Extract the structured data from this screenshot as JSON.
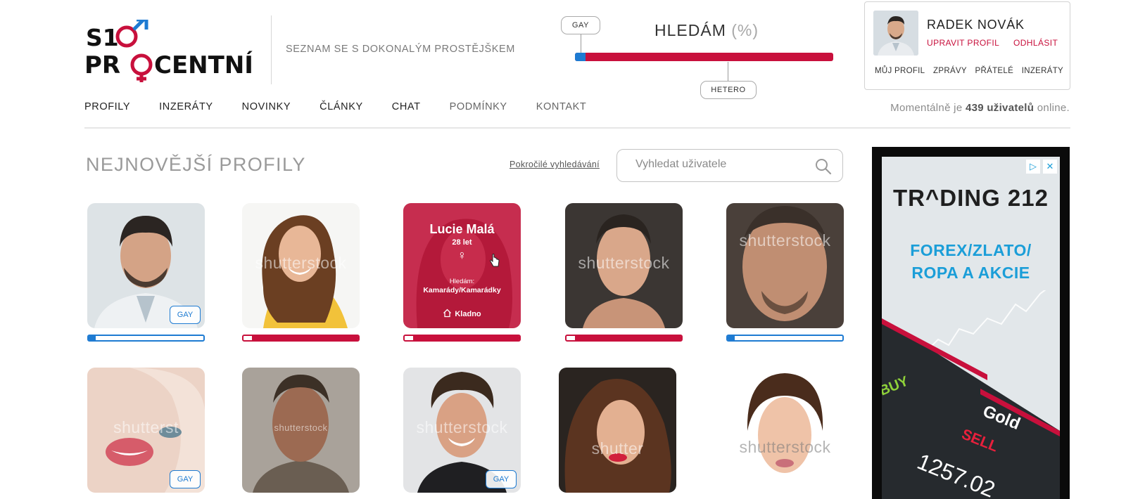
{
  "header": {
    "logo_line1": "S10",
    "logo_line2": "PROCENTNÍ",
    "tagline": "SEZNAM SE S DOKONALÝM PROSTĚJŠKEM",
    "seek_title": "HLEDÁM",
    "seek_unit": "(%)",
    "seek_left_label": "GAY",
    "seek_right_label": "HETERO",
    "seek_level": 0.04
  },
  "user": {
    "name": "RADEK NOVÁK",
    "edit_label": "UPRAVIT PROFIL",
    "logout_label": "ODHLÁSIT",
    "links": [
      "MŮJ PROFIL",
      "ZPRÁVY",
      "PŘÁTELÉ",
      "INZERÁTY"
    ]
  },
  "nav": {
    "items": [
      "PROFILY",
      "INZERÁTY",
      "NOVINKY",
      "ČLÁNKY",
      "CHAT",
      "PODMÍNKY",
      "KONTAKT"
    ]
  },
  "online": {
    "prefix": "Momentálně je",
    "count": "439 uživatelů",
    "suffix": "online."
  },
  "content": {
    "title": "NEJNOVĚJŠÍ PROFILY",
    "advanced_search": "Pokročilé vyhledávání",
    "search_placeholder": "Vyhledat uživatele"
  },
  "profiles": [
    {
      "tag": "GAY",
      "level": 0.06,
      "color": "#1e7bd2",
      "watermark": ""
    },
    {
      "tag": "",
      "level": 1.0,
      "color": "#c8103c",
      "watermark": "shutterstock"
    },
    {
      "tag": "",
      "level": 1.0,
      "color": "#c8103c",
      "watermark": ""
    },
    {
      "tag": "",
      "level": 1.0,
      "color": "#c8103c",
      "watermark": "shutterstock"
    },
    {
      "tag": "",
      "level": 0.06,
      "color": "#1e7bd2",
      "watermark": "shutterstock"
    },
    {
      "tag": "GAY",
      "watermark": "shutterst"
    },
    {
      "tag": "",
      "watermark": "shutterstock"
    },
    {
      "tag": "GAY",
      "watermark": "shutterstock"
    },
    {
      "tag": "",
      "watermark": "shutter"
    },
    {
      "tag": "",
      "watermark": "shutterstock"
    }
  ],
  "hover_card": {
    "name": "Lucie Malá",
    "age": "28 let",
    "symbol": "♀",
    "seeking_label": "Hledám:",
    "seeking_value": "Kamarády/Kamarádky",
    "city": "Kladno"
  },
  "ad": {
    "brand": "TR^DING 212",
    "line1": "FOREX/ZLATO/",
    "line2": "ROPA A AKCIE",
    "buy": "BUY",
    "sell": "SELL",
    "gold": "Gold",
    "price": "1257.02",
    "accent": "#1b9ed8"
  },
  "colors": {
    "accent_red": "#c8103c",
    "accent_blue": "#1e7bd2"
  },
  "icons": {
    "search": "magnifier-icon",
    "home": "house-icon",
    "ad_choices": "ad-choices-icon",
    "close": "close-icon",
    "cursor": "hand-cursor-icon"
  }
}
